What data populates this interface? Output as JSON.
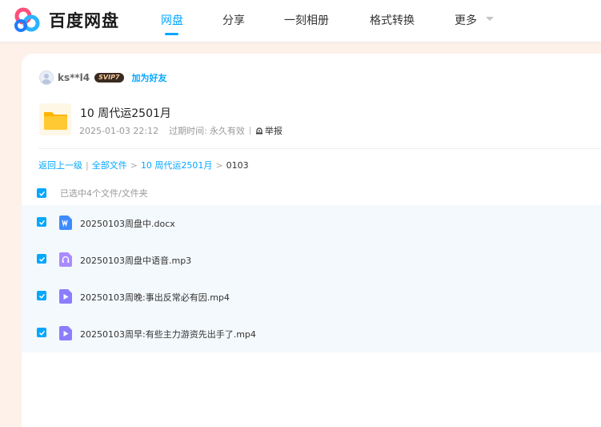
{
  "header": {
    "logo_text": "百度网盘",
    "nav": [
      {
        "label": "网盘",
        "active": true
      },
      {
        "label": "分享",
        "active": false
      },
      {
        "label": "一刻相册",
        "active": false
      },
      {
        "label": "格式转换",
        "active": false
      },
      {
        "label": "更多",
        "active": false
      }
    ]
  },
  "share": {
    "user": {
      "name": "ks**l4",
      "badge": "SVIP7",
      "add_friend": "加为好友"
    },
    "title": "10 周代运2501月",
    "date": "2025-01-03 22:12",
    "expire_label": "过期时间:",
    "expire_value": "永久有效",
    "report": "举报"
  },
  "breadcrumb": {
    "back": "返回上一级",
    "items": [
      "全部文件",
      "10 周代运2501月"
    ],
    "current": "0103"
  },
  "selection": {
    "text": "已选中4个文件/文件夹"
  },
  "files": [
    {
      "name": "20250103周盘中.docx",
      "type": "doc-icon",
      "checked": true
    },
    {
      "name": "20250103周盘中语音.mp3",
      "type": "audio-icon",
      "checked": true
    },
    {
      "name": "20250103周晚:事出反常必有因.mp4",
      "type": "video-icon",
      "checked": true
    },
    {
      "name": "20250103周早:有些主力游资先出手了.mp4",
      "type": "video-icon",
      "checked": true
    }
  ],
  "colors": {
    "accent": "#06a7ff",
    "page_bg": "#fdf1ea",
    "list_bg": "#f4f9fd",
    "folder": "#ffc21f"
  }
}
